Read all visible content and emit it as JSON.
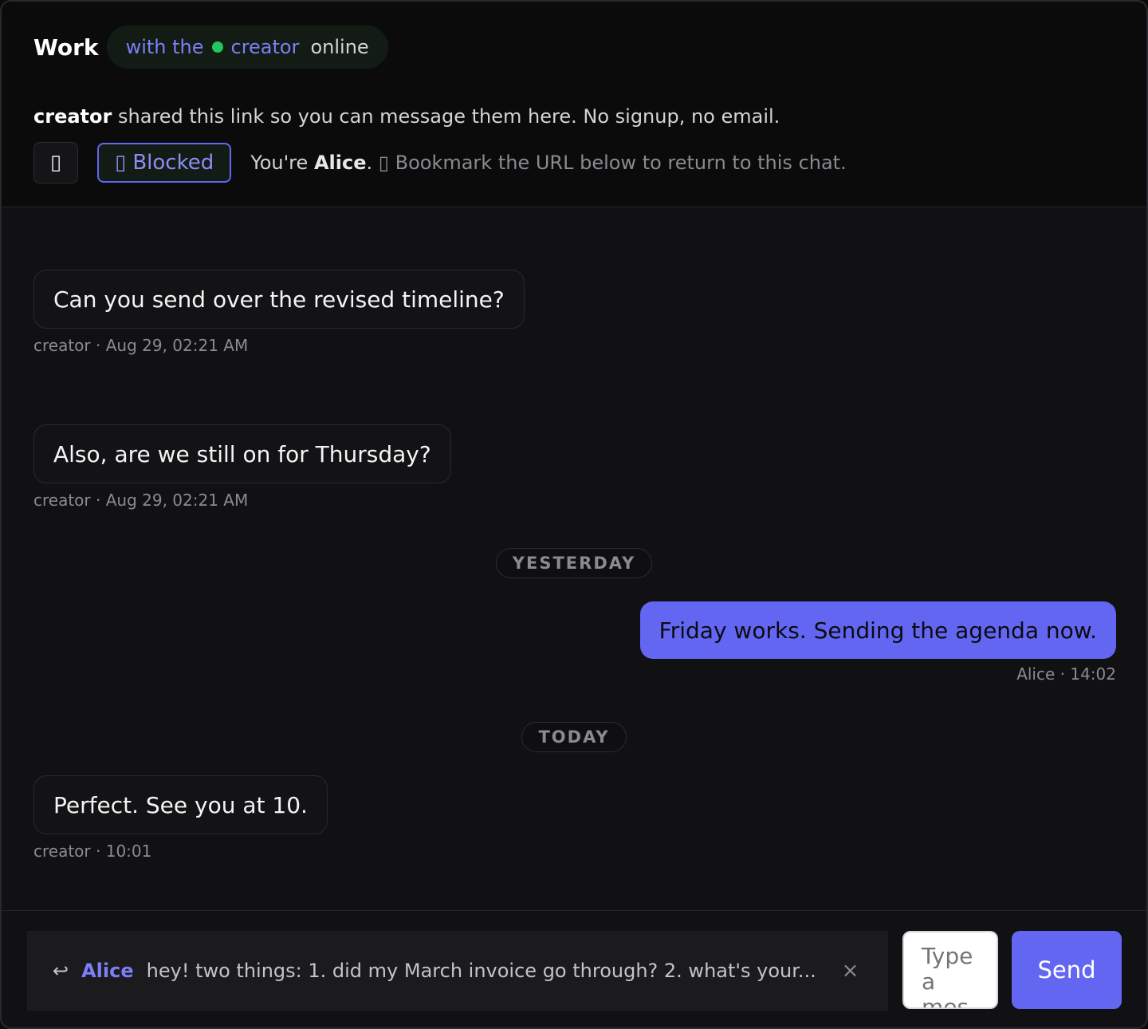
{
  "header": {
    "room_title": "Work",
    "presence": {
      "prefix": "with the",
      "name": "creator",
      "status": "online"
    },
    "share": {
      "name": "creator",
      "text": "shared this link so you can message them here. No signup, no email."
    },
    "icon_button_glyph": "▯",
    "blocked": {
      "glyph": "▯",
      "label": "Blocked"
    },
    "identity": {
      "prefix": "You're",
      "name": "Alice",
      "suffix": ".",
      "glyph": "▯",
      "hint": "Bookmark the URL below to return to this chat."
    }
  },
  "messages": [
    {
      "text": "Can you send over the revised timeline?",
      "meta": "creator · Aug 29, 02:21 AM",
      "mine": false
    },
    {
      "text": "Also, are we still on for Thursday?",
      "meta": "creator · Aug 29, 02:21 AM",
      "mine": false
    },
    {
      "text": "Friday works. Sending the agenda now.",
      "meta": "Alice · 14:02",
      "mine": true
    },
    {
      "text": "Perfect. See you at 10.",
      "meta": "creator · 10:01",
      "mine": false
    }
  ],
  "separators": {
    "yesterday": "YESTERDAY",
    "today": "TODAY"
  },
  "composer": {
    "reply": {
      "arrow": "↩",
      "name": "Alice",
      "text": "hey! two things: 1. did my March invoice go through? 2. what's your...",
      "close": "×"
    },
    "placeholder": "Type a message...",
    "send_label": "Send"
  },
  "colors": {
    "accent": "#6366f1",
    "online": "#22c55e",
    "background": "#111113",
    "header_background": "#0b0b0c"
  },
  "icons": [
    "chat-icon",
    "block-icon",
    "bookmark-icon",
    "reply-arrow-icon",
    "close-icon",
    "online-dot-icon"
  ]
}
